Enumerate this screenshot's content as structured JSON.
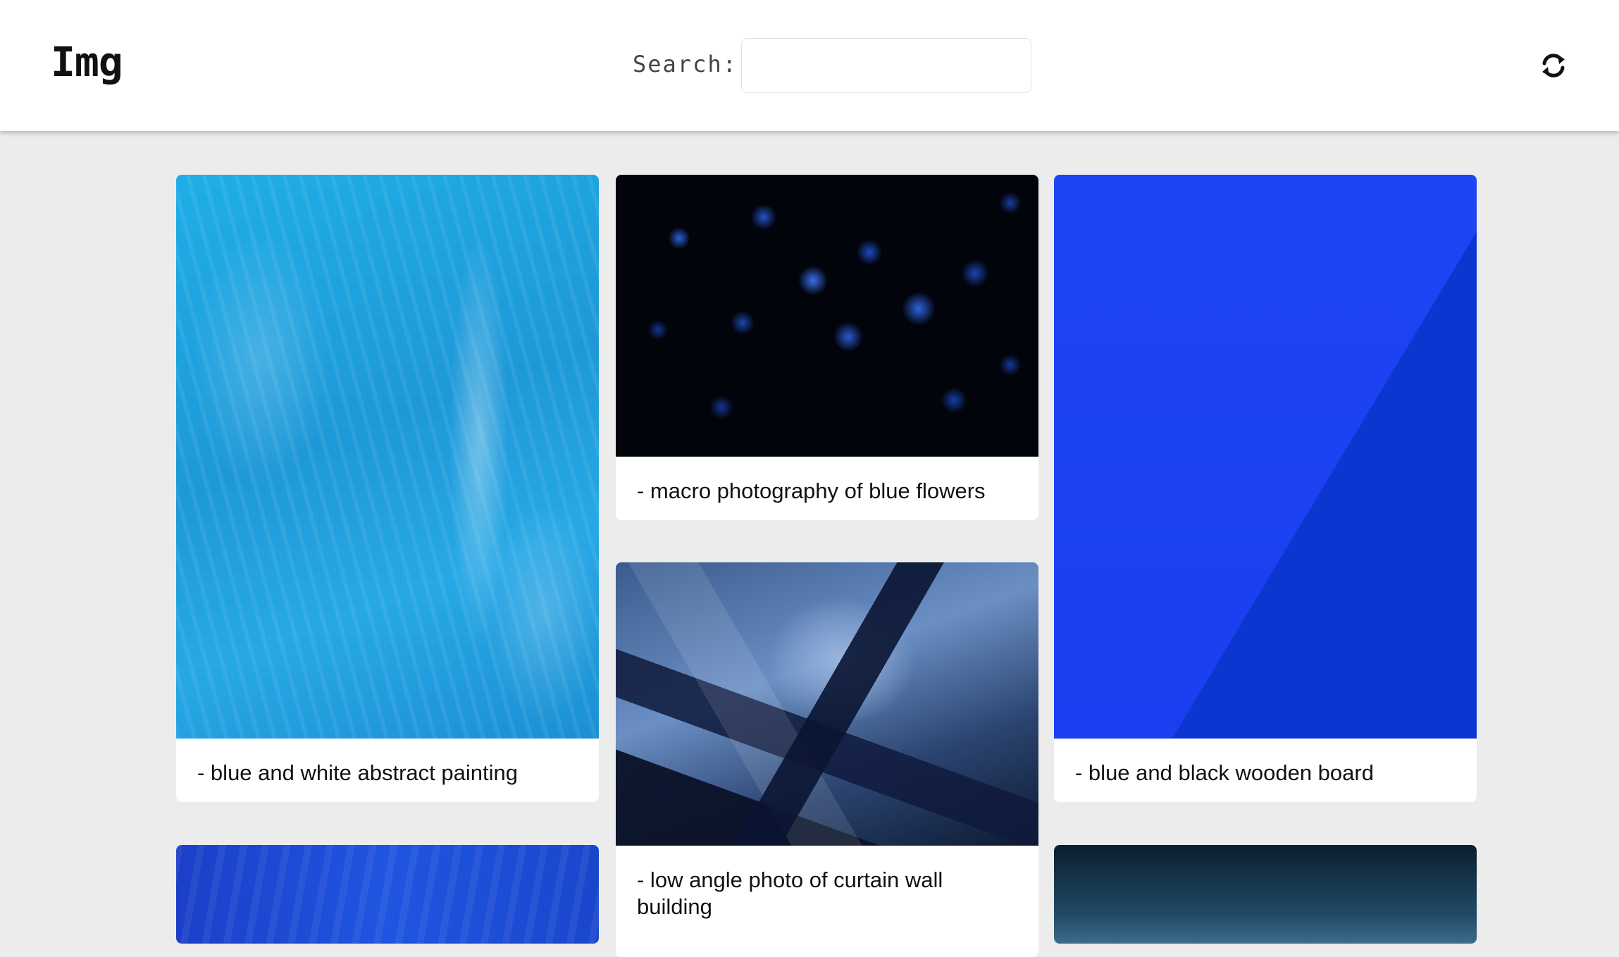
{
  "app": {
    "logo": "Img"
  },
  "search": {
    "label": "Search:",
    "value": "",
    "placeholder": ""
  },
  "toolbar": {
    "refresh_icon": "refresh-icon"
  },
  "gallery": {
    "cards": [
      {
        "caption": "- blue and white abstract painting"
      },
      {
        "caption": "- macro photography of blue flowers"
      },
      {
        "caption": "- blue and black wooden board"
      },
      {
        "caption": "- low angle photo of curtain wall building"
      },
      {
        "caption": ""
      },
      {
        "caption": ""
      }
    ]
  }
}
